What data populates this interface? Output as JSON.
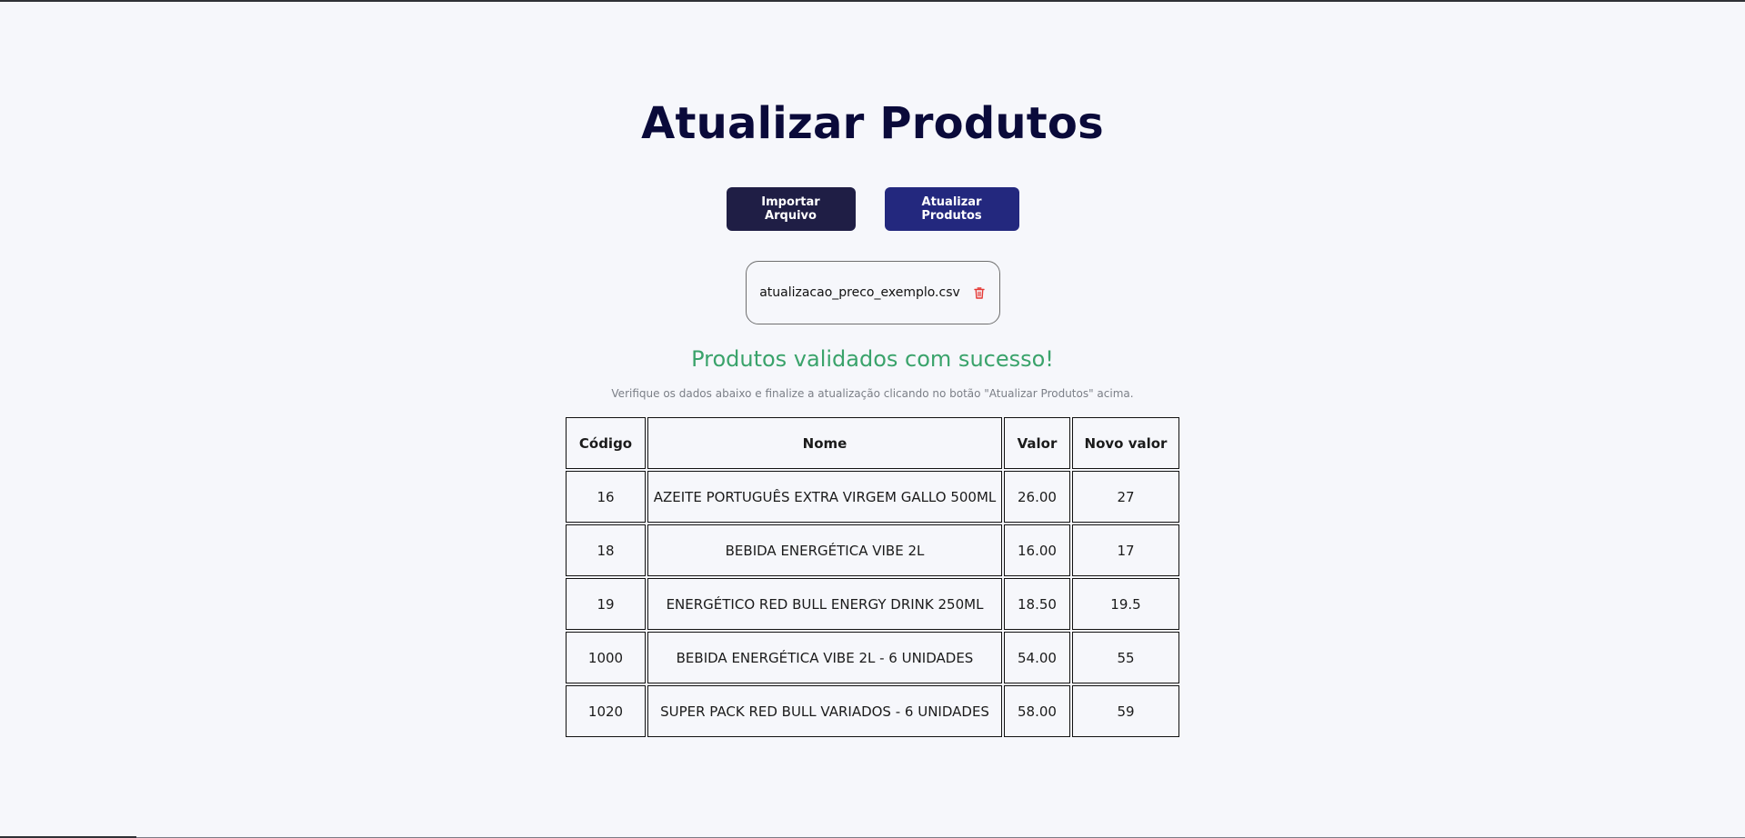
{
  "page": {
    "title": "Atualizar Produtos"
  },
  "actions": {
    "import_label": "Importar Arquivo",
    "update_label": "Atualizar Produtos"
  },
  "file": {
    "name": "atualizacao_preco_exemplo.csv",
    "delete_icon": "trash-icon"
  },
  "status": {
    "success": "Produtos validados com sucesso!",
    "hint": "Verifique os dados abaixo e finalize a atualização clicando no botão \"Atualizar Produtos\" acima."
  },
  "table": {
    "headers": [
      "Código",
      "Nome",
      "Valor",
      "Novo valor"
    ],
    "rows": [
      {
        "codigo": "16",
        "nome": "AZEITE PORTUGUÊS EXTRA VIRGEM GALLO 500ML",
        "valor": "26.00",
        "novo": "27"
      },
      {
        "codigo": "18",
        "nome": "BEBIDA ENERGÉTICA VIBE 2L",
        "valor": "16.00",
        "novo": "17"
      },
      {
        "codigo": "19",
        "nome": "ENERGÉTICO RED BULL ENERGY DRINK 250ML",
        "valor": "18.50",
        "novo": "19.5"
      },
      {
        "codigo": "1000",
        "nome": "BEBIDA ENERGÉTICA VIBE 2L - 6 UNIDADES",
        "valor": "54.00",
        "novo": "55"
      },
      {
        "codigo": "1020",
        "nome": "SUPER PACK RED BULL VARIADOS - 6 UNIDADES",
        "valor": "58.00",
        "novo": "59"
      }
    ]
  },
  "colors": {
    "title": "#0a0a3a",
    "import_button": "#1f1e45",
    "update_button": "#23287e",
    "success": "#3aa36b",
    "delete_icon": "#e53935",
    "background": "#f6f7fb"
  }
}
